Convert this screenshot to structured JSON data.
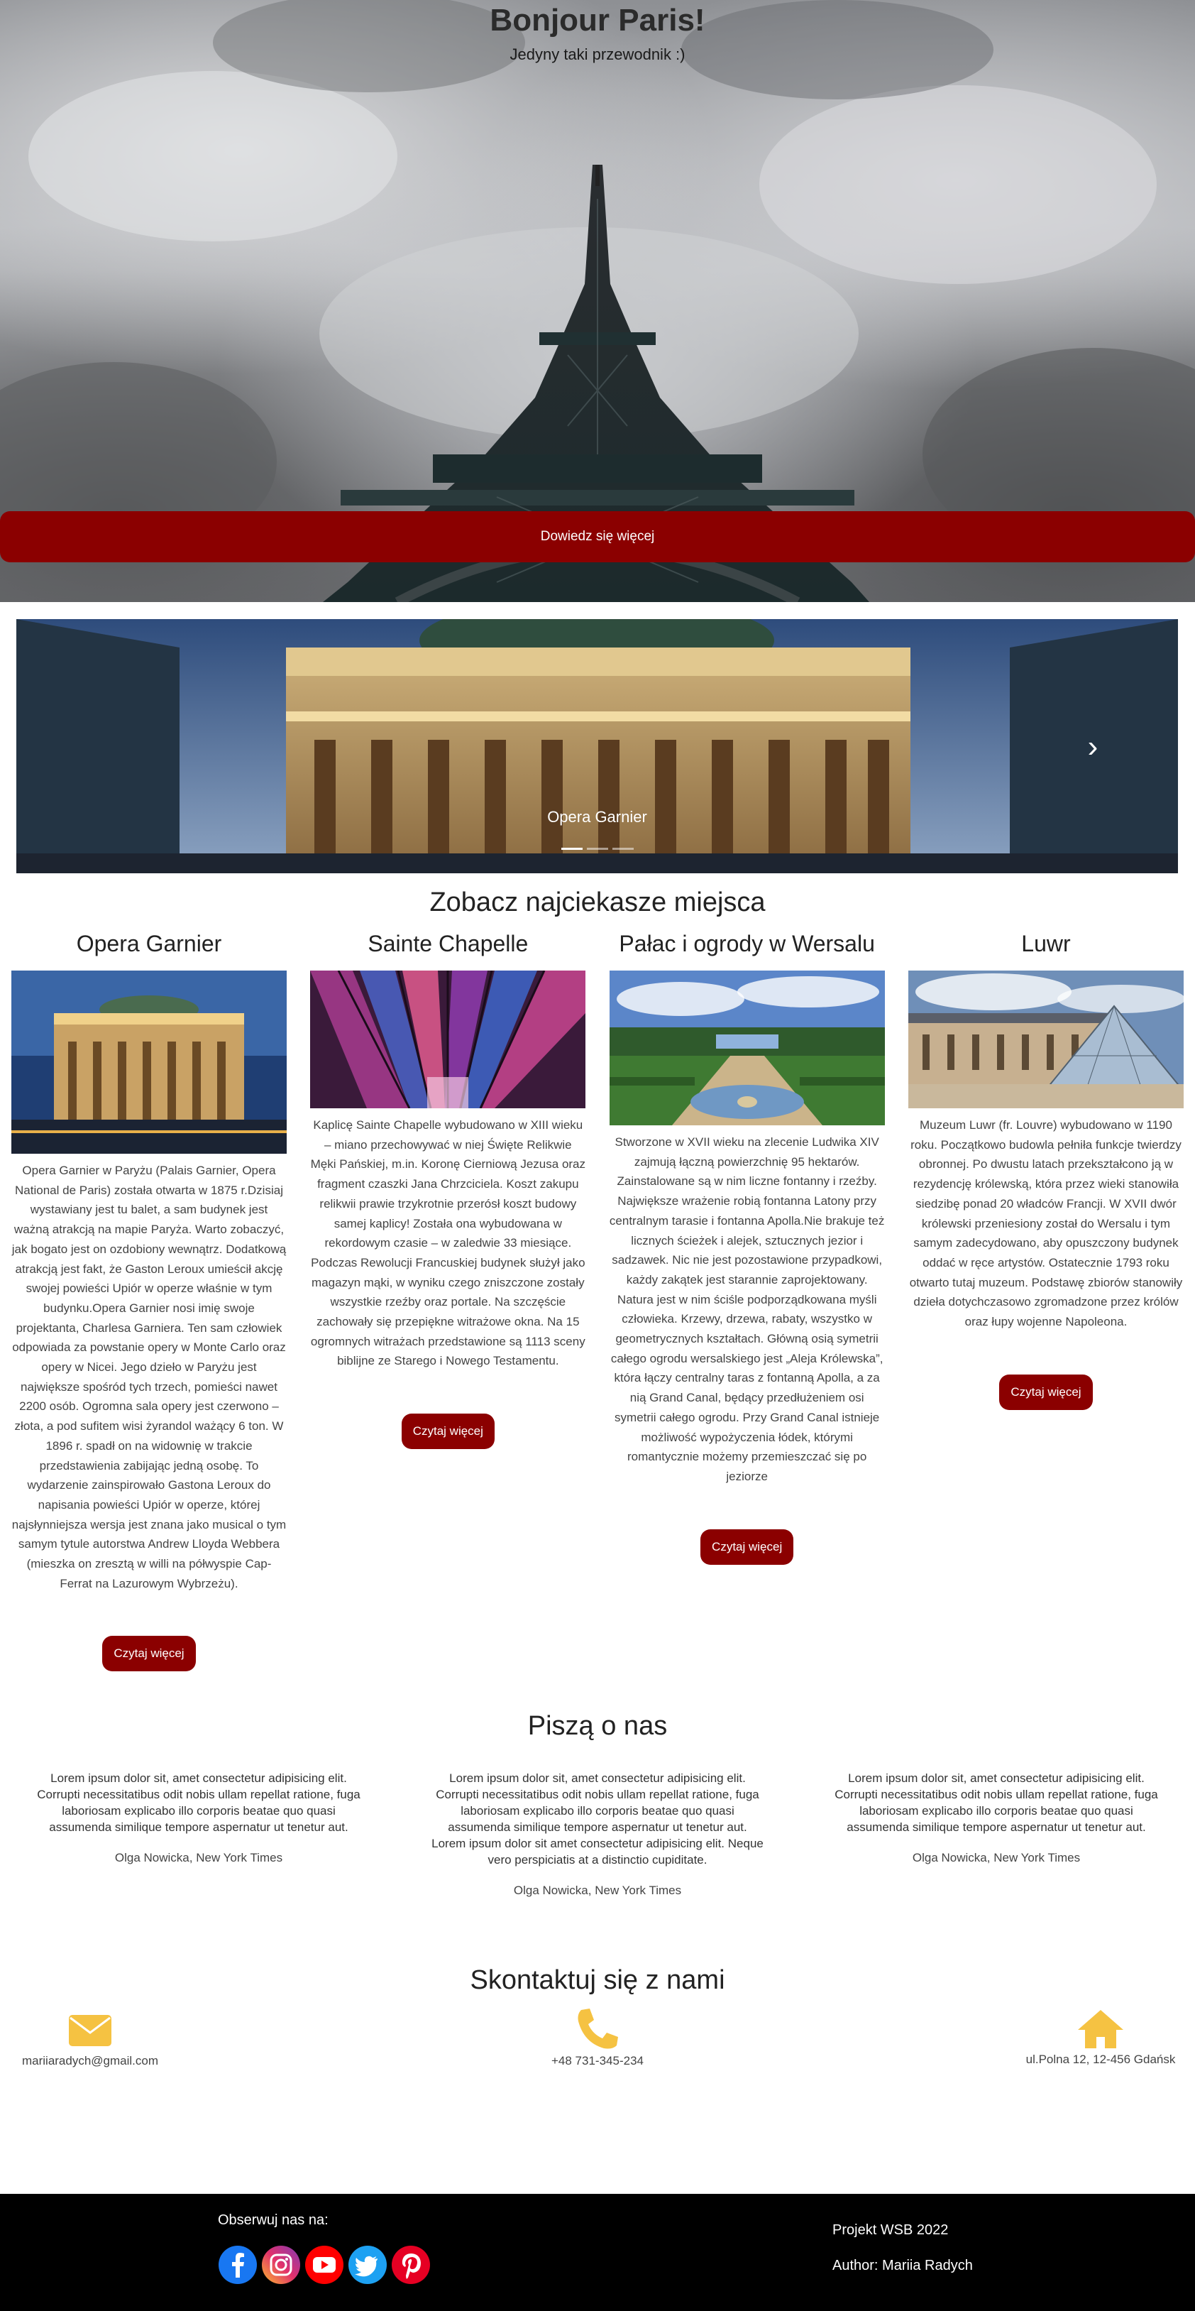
{
  "hero": {
    "title": "Bonjour Paris!",
    "subtitle": "Jedyny taki przewodnik :)",
    "button_label": "Dowiedz się więcej"
  },
  "carousel": {
    "caption": "Opera Garnier",
    "next_icon": "chevron-right-icon",
    "slides_count_visible": 3
  },
  "places": {
    "title": "Zobacz najciekasze miejsca",
    "items": [
      {
        "name": "Opera Garnier",
        "text": "Opera Garnier w Paryżu (Palais Garnier, Opera National de Paris) została otwarta w 1875 r.Dzisiaj wystawiany jest tu balet, a sam budynek jest ważną atrakcją na mapie Paryża. Warto zobaczyć, jak bogato jest on ozdobiony wewnątrz. Dodatkową atrakcją jest fakt, że Gaston Leroux umieścił akcję swojej powieści Upiór w operze właśnie w tym budynku.Opera Garnier nosi imię swoje projektanta, Charlesa Garniera. Ten sam człowiek odpowiada za powstanie opery w Monte Carlo oraz opery w Nicei. Jego dzieło w Paryżu jest największe spośród tych trzech, pomieści nawet 2200 osób. Ogromna sala opery jest czerwono – złota, a pod sufitem wisi żyrandol ważący 6 ton. W 1896 r. spadł on na widownię w trakcie przedstawienia zabijając jedną osobę. To wydarzenie zainspirowało Gastona Leroux do napisania powieści Upiór w operze, której najsłynniejsza wersja jest znana jako musical o tym samym tytule autorstwa Andrew Lloyda Webbera (mieszka on zresztą w willi na półwyspie Cap-Ferrat na Lazurowym Wybrzeżu).",
        "button": "Czytaj więcej"
      },
      {
        "name": "Sainte Chapelle",
        "text": "Kaplicę Sainte Chapelle wybudowano w XIII wieku – miano przechowywać w niej Święte Relikwie Męki Pańskiej, m.in. Koronę Cierniową Jezusa oraz fragment czaszki Jana Chrzciciela. Koszt zakupu relikwii prawie trzykrotnie przerósł koszt budowy samej kaplicy! Została ona wybudowana w rekordowym czasie – w zaledwie 33 miesiące. Podczas Rewolucji Francuskiej budynek służył jako magazyn mąki, w wyniku czego zniszczone zostały wszystkie rzeźby oraz portale. Na szczęście zachowały się przepiękne witrażowe okna. Na 15 ogromnych witrażach przedstawione są 1113 sceny biblijne ze Starego i Nowego Testamentu.",
        "button": "Czytaj więcej"
      },
      {
        "name": "Pałac i ogrody w Wersalu",
        "text": "Stworzone w XVII wieku na zlecenie Ludwika XIV zajmują łączną powierzchnię 95 hektarów. Zainstalowane są w nim liczne fontanny i rzeźby. Największe wrażenie robią fontanna Latony przy centralnym tarasie i fontanna Apolla.Nie brakuje też licznych ścieżek i alejek, sztucznych jezior i sadzawek. Nic nie jest pozostawione przypadkowi, każdy zakątek jest starannie zaprojektowany. Natura jest w nim ściśle podporządkowana myśli człowieka. Krzewy, drzewa, rabaty, wszystko w geometrycznych kształtach. Główną osią symetrii całego ogrodu wersalskiego jest „Aleja Królewska”, która łączy centralny taras z fontanną Apolla, a za nią Grand Canal, będący przedłużeniem osi symetrii całego ogrodu. Przy Grand Canal istnieje możliwość wypożyczenia łódek, którymi romantycznie możemy przemieszczać się po jeziorze",
        "button": "Czytaj więcej"
      },
      {
        "name": "Luwr",
        "text": "Muzeum Luwr (fr. Louvre) wybudowano w 1190 roku. Początkowo budowla pełniła funkcje twierdzy obronnej. Po dwustu latach przekształcono ją w rezydencję królewską, która przez wieki stanowiła siedzibę ponad 20 władców Francji. W XVII dwór królewski przeniesiony został do Wersalu i tym samym zadecydowano, aby opuszczony budynek oddać w ręce artystów. Ostatecznie 1793 roku otwarto tutaj muzeum. Podstawę zbiorów stanowiły dzieła dotychczasowo zgromadzone przez królów oraz łupy wojenne Napoleona.",
        "button": "Czytaj więcej"
      }
    ]
  },
  "testimonials": {
    "title": "Piszą o nas",
    "items": [
      {
        "text": "Lorem ipsum dolor sit, amet consectetur adipisicing elit. Corrupti necessitatibus odit nobis ullam repellat ratione, fuga laboriosam explicabo illo corporis beatae quo quasi assumenda similique tempore aspernatur ut tenetur aut.",
        "author": "Olga Nowicka, New York Times"
      },
      {
        "text": "Lorem ipsum dolor sit, amet consectetur adipisicing elit. Corrupti necessitatibus odit nobis ullam repellat ratione, fuga laboriosam explicabo illo corporis beatae quo quasi assumenda similique tempore aspernatur ut tenetur aut. Lorem ipsum dolor sit amet consectetur adipisicing elit. Neque vero perspiciatis at a distinctio cupiditate.",
        "author": "Olga Nowicka, New York Times"
      },
      {
        "text": "Lorem ipsum dolor sit, amet consectetur adipisicing elit. Corrupti necessitatibus odit nobis ullam repellat ratione, fuga laboriosam explicabo illo corporis beatae quo quasi assumenda similique tempore aspernatur ut tenetur aut.",
        "author": "Olga Nowicka, New York Times"
      }
    ]
  },
  "contact": {
    "title": "Skontaktuj się z nami",
    "email": "mariiaradych@gmail.com",
    "phone": "+48 731-345-234",
    "address": "ul.Polna 12, 12-456 Gdańsk",
    "email_icon": "envelope-icon",
    "phone_icon": "phone-icon",
    "address_icon": "home-icon",
    "icon_color": "#f5c242"
  },
  "footer": {
    "follow_label": "Obserwuj nas na:",
    "project": "Projekt WSB 2022",
    "author": "Author: Mariia Radych",
    "socials": [
      {
        "name": "facebook-icon",
        "color": "#1877f2"
      },
      {
        "name": "instagram-icon",
        "color": "#d6249f"
      },
      {
        "name": "youtube-icon",
        "color": "#ff0000"
      },
      {
        "name": "twitter-icon",
        "color": "#1da1f2"
      },
      {
        "name": "pinterest-icon",
        "color": "#e60023"
      }
    ]
  },
  "colors": {
    "accent": "#8b0000",
    "footer_bg": "#000000",
    "icon_yellow": "#f5c242"
  }
}
